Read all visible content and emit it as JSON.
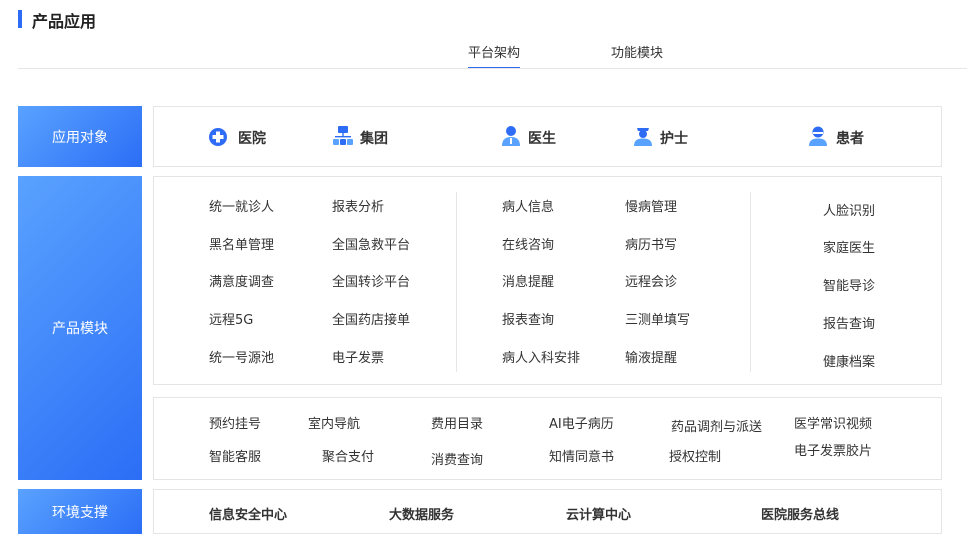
{
  "page": {
    "title": "产品应用"
  },
  "tabs": [
    {
      "label": "平台架构",
      "active": true
    },
    {
      "label": "功能模块",
      "active": false
    }
  ],
  "labels": {
    "objects": "应用对象",
    "modules": "产品模块",
    "env": "环境支撑"
  },
  "objects": [
    {
      "label": "医院",
      "icon": "hospital-icon"
    },
    {
      "label": "集团",
      "icon": "group-icon"
    },
    {
      "label": "医生",
      "icon": "doctor-icon"
    },
    {
      "label": "护士",
      "icon": "nurse-icon"
    },
    {
      "label": "患者",
      "icon": "patient-icon"
    }
  ],
  "modules": {
    "hospital_col1": [
      "统一就诊人",
      "黑名单管理",
      "满意度调查",
      "远程5G",
      "统一号源池"
    ],
    "hospital_col2": [
      "报表分析",
      "全国急救平台",
      "全国转诊平台",
      "全国药店接单",
      "电子发票"
    ],
    "doctor_col1": [
      "病人信息",
      "在线咨询",
      "消息提醒",
      "报表查询",
      "病人入科安排"
    ],
    "doctor_col2": [
      "慢病管理",
      "病历书写",
      "远程会诊",
      "三测单填写",
      "输液提醒"
    ],
    "patient_col": [
      "人脸识别",
      "家庭医生",
      "智能导诊",
      "报告查询",
      "健康档案"
    ]
  },
  "extras": {
    "row1": [
      "预约挂号",
      "室内导航",
      "费用目录",
      "AI电子病历",
      "药品调剂与派送",
      "医学常识视频"
    ],
    "row2": [
      "智能客服",
      "聚合支付",
      "消费查询",
      "知情同意书",
      "授权控制",
      "电子发票胶片"
    ]
  },
  "env": [
    "信息安全中心",
    "大数据服务",
    "云计算中心",
    "医院服务总线"
  ],
  "colors": {
    "accent": "#2f6cf6",
    "label_gradient_start": "#5aa2ff",
    "label_gradient_end": "#2b6ef6"
  }
}
